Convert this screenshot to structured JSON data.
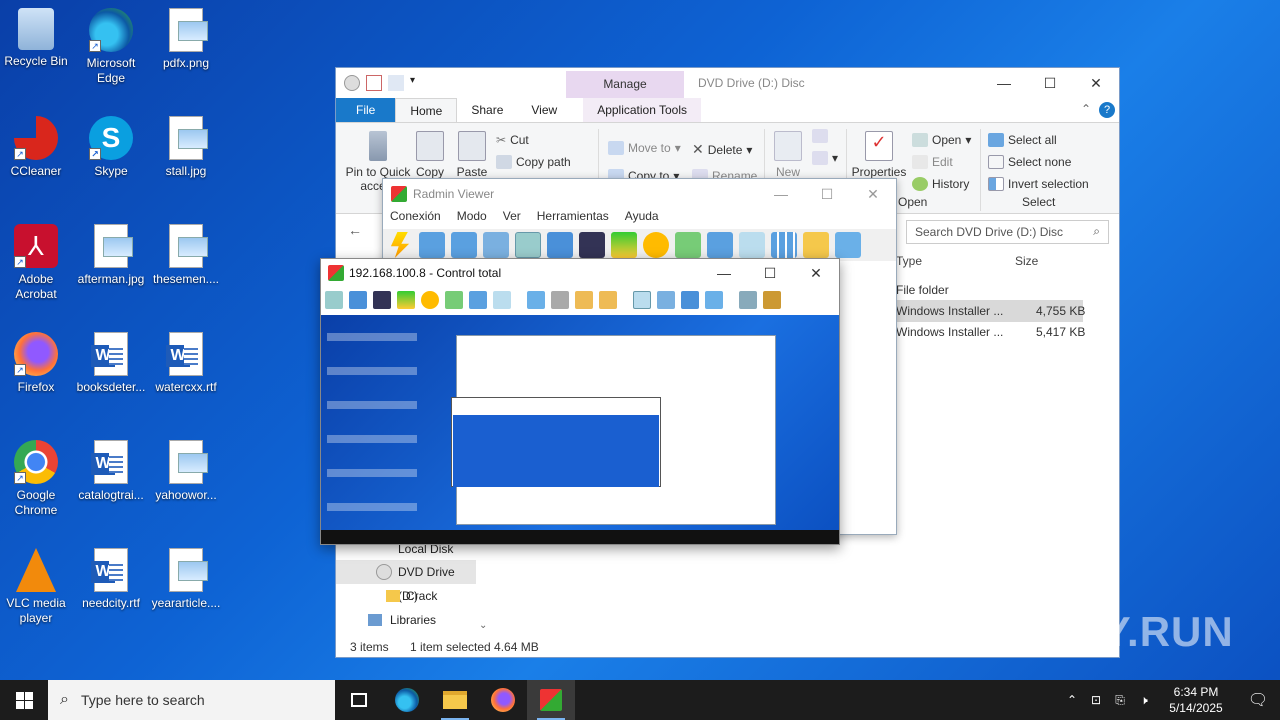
{
  "desktop": {
    "icons": [
      {
        "label": "Recycle Bin"
      },
      {
        "label": "Microsoft Edge"
      },
      {
        "label": "pdfx.png"
      },
      {
        "label": "CCleaner"
      },
      {
        "label": "Skype"
      },
      {
        "label": "stall.jpg"
      },
      {
        "label": "Adobe Acrobat"
      },
      {
        "label": "afterman.jpg"
      },
      {
        "label": "thesemen...."
      },
      {
        "label": "Firefox"
      },
      {
        "label": "booksdeter..."
      },
      {
        "label": "watercxx.rtf"
      },
      {
        "label": "Google Chrome"
      },
      {
        "label": "catalogtrai..."
      },
      {
        "label": "yahoowor..."
      },
      {
        "label": "VLC media player"
      },
      {
        "label": "needcity.rtf"
      },
      {
        "label": "yeararticle...."
      }
    ]
  },
  "explorer": {
    "title": "DVD Drive (D:) Disc",
    "manage_tab": "Manage",
    "tabs": {
      "file": "File",
      "home": "Home",
      "share": "Share",
      "view": "View",
      "app_tools": "Application Tools"
    },
    "ribbon": {
      "pin": "Pin to Quick acce...",
      "copy": "Copy",
      "paste": "Paste",
      "cut": "Cut",
      "copy_path": "Copy path",
      "move_to": "Move to",
      "copy_to": "Copy to",
      "delete": "Delete",
      "rename": "Rename",
      "new": "New",
      "properties": "Properties",
      "open": "Open",
      "edit": "Edit",
      "history": "History",
      "open_group": "Open",
      "select_all": "Select all",
      "select_none": "Select none",
      "invert_selection": "Invert selection",
      "select_group": "Select"
    },
    "search_placeholder": "Search DVD Drive (D:) Disc",
    "columns": {
      "type": "Type",
      "size": "Size"
    },
    "rows": [
      {
        "type": "File folder",
        "size": ""
      },
      {
        "type": "Windows Installer ...",
        "size": "4,755 KB"
      },
      {
        "type": "Windows Installer ...",
        "size": "5,417 KB"
      }
    ],
    "nav": {
      "local_disk": "Local Disk (C:)",
      "dvd": "DVD Drive (D:)",
      "crack": "Crack",
      "libraries": "Libraries"
    },
    "status": {
      "items": "3 items",
      "selected": "1 item selected  4.64 MB"
    }
  },
  "radmin": {
    "title": "Radmin Viewer",
    "menu": [
      "Conexión",
      "Modo",
      "Ver",
      "Herramientas",
      "Ayuda"
    ]
  },
  "control": {
    "title": "192.168.100.8 - Control total"
  },
  "taskbar": {
    "search_placeholder": "Type here to search",
    "time": "6:34 PM",
    "date": "5/14/2025"
  },
  "watermark": "ANY.RUN",
  "colors": {
    "accent": "#1979ca",
    "desktop": "#0e63d4"
  }
}
